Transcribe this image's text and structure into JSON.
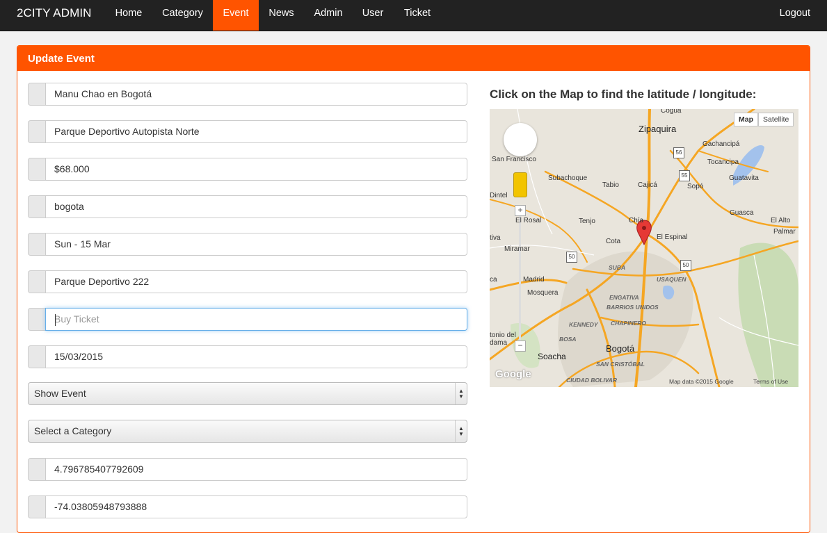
{
  "navbar": {
    "brand": "2CITY ADMIN",
    "items": [
      {
        "label": "Home",
        "active": false
      },
      {
        "label": "Category",
        "active": false
      },
      {
        "label": "Event",
        "active": true
      },
      {
        "label": "News",
        "active": false
      },
      {
        "label": "Admin",
        "active": false
      },
      {
        "label": "User",
        "active": false
      },
      {
        "label": "Ticket",
        "active": false
      }
    ],
    "logout": "Logout"
  },
  "panel": {
    "title": "Update Event"
  },
  "form": {
    "name": "Manu Chao en Bogotá",
    "location": "Parque Deportivo Autopista Norte",
    "price": "$68.000",
    "city": "bogota",
    "date_text": "Sun - 15 Mar",
    "address": "Parque Deportivo 222",
    "ticket_url_placeholder": "Buy Ticket",
    "date": "15/03/2015",
    "visibility": "Show Event",
    "category": "Select a Category",
    "latitude": "4.796785407792609",
    "longitude": "-74.03805948793888"
  },
  "map": {
    "title": "Click on the Map to find the latitude / longitude:",
    "type_map": "Map",
    "type_satellite": "Satellite",
    "zoom_in": "+",
    "zoom_out": "−",
    "attribution": "Map data ©2015 Google",
    "terms": "Terms of Use",
    "logo": "Google",
    "labels": {
      "cogua": "Cogua",
      "zipaquira": "Zipaquira",
      "gachancipa": "Gachancipá",
      "san_francisco": "San Francisco",
      "tocancipa": "Tocancipa",
      "subachoque": "Subachoque",
      "tabio": "Tabio",
      "cajica": "Cajicá",
      "sopo": "Sopó",
      "guatavita": "Guatavita",
      "dintel": "Dintel",
      "guasca": "Guasca",
      "el_rosal": "El Rosal",
      "tenjo": "Tenjo",
      "chia": "Chía",
      "el_alto": "El Alto",
      "palmar": "Palmar",
      "el_espinal": "El Espinal",
      "tiva": "tiva",
      "cota": "Cota",
      "miramar": "Miramar",
      "suba": "SUBA",
      "usaquen": "USAQUEN",
      "madrid": "Madrid",
      "ca": "ca",
      "mosquera": "Mosquera",
      "engativa": "ENGATIVA",
      "barrios_unidos": "BARRIOS UNIDOS",
      "kennedy": "KENNEDY",
      "chapinero": "CHAPINERO",
      "antonio": "tonio del",
      "dama": "dama",
      "bosa": "BOSA",
      "bogota": "Bogotá",
      "soacha": "Soacha",
      "san_cristobal": "SAN CRISTÓBAL",
      "ciudad_bolivar": "CIUDAD BOLIVAR",
      "r50a": "50",
      "r50b": "50",
      "r55": "55",
      "r56": "56"
    }
  }
}
